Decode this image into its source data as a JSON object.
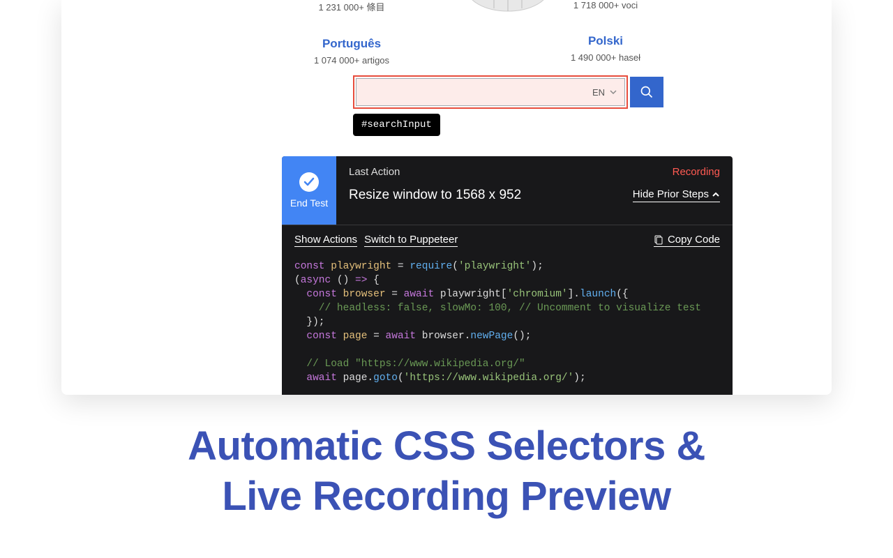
{
  "wiki": {
    "left_top_count": "1 231 000+ 條目",
    "right_top_count": "1 718 000+ voci",
    "left_lang_name": "Português",
    "left_lang_count": "1 074 000+ artigos",
    "right_lang_name": "Polski",
    "right_lang_count": "1 490 000+ haseł",
    "search_lang": "EN",
    "selector_tip": "#searchInput"
  },
  "recorder": {
    "end_test": "End Test",
    "last_action_label": "Last Action",
    "recording_label": "Recording",
    "action_text": "Resize window to 1568 x 952",
    "hide_prior": "Hide Prior Steps",
    "show_actions": "Show Actions",
    "switch_to": "Switch to Puppeteer",
    "copy_code": "Copy Code"
  },
  "code": {
    "l1a": "const",
    "l1b": "playwright",
    "l1c": " = ",
    "l1d": "require",
    "l1e": "(",
    "l1f": "'playwright'",
    "l1g": ");",
    "l2a": "(",
    "l2b": "async",
    "l2c": " () ",
    "l2d": "=>",
    "l2e": " {",
    "l3a": "  const",
    "l3b": " browser",
    "l3c": " = ",
    "l3d": "await",
    "l3e": " playwright[",
    "l3f": "'chromium'",
    "l3g": "].",
    "l3h": "launch",
    "l3i": "({",
    "l4a": "    // headless: false, slowMo: 100, // Uncomment to visualize test",
    "l5a": "  });",
    "l6a": "  const",
    "l6b": " page",
    "l6c": " = ",
    "l6d": "await",
    "l6e": " browser.",
    "l6f": "newPage",
    "l6g": "();",
    "l7a": "",
    "l8a": "  // Load \"https://www.wikipedia.org/\"",
    "l9a": "  await",
    "l9b": " page.",
    "l9c": "goto",
    "l9d": "(",
    "l9e": "'https://www.wikipedia.org/'",
    "l9f": ");"
  },
  "hero": {
    "line1": "Automatic CSS Selectors &",
    "line2": "Live Recording Preview"
  }
}
